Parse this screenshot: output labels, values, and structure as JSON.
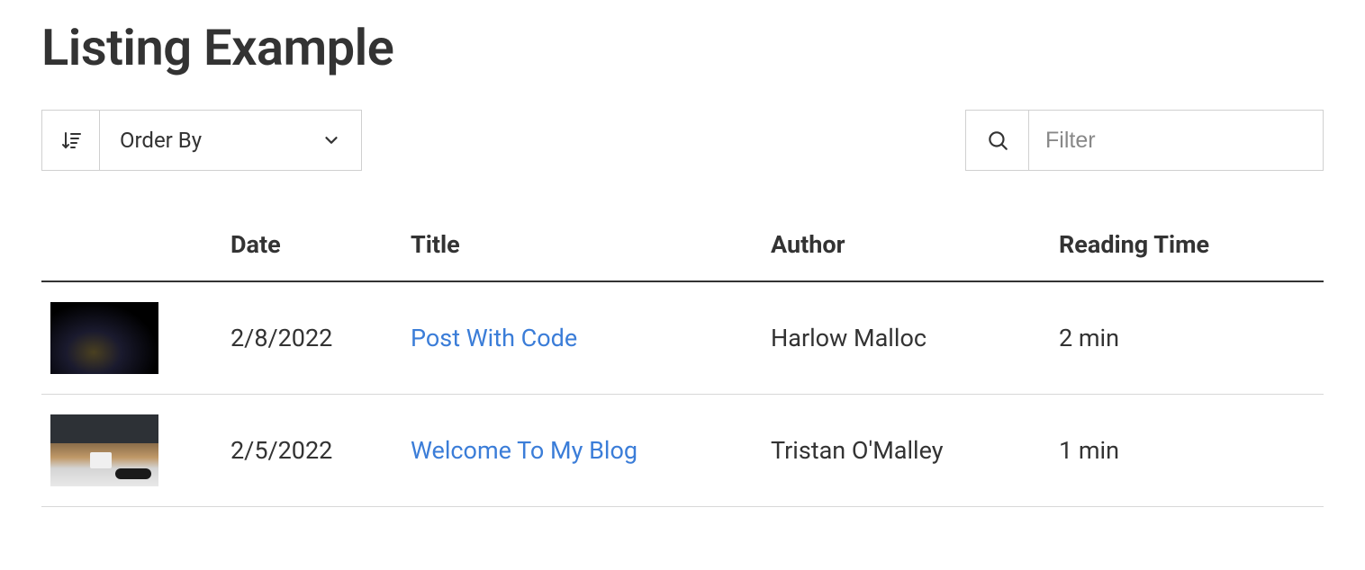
{
  "page": {
    "title": "Listing Example"
  },
  "toolbar": {
    "orderby_label": "Order By",
    "filter_placeholder": "Filter"
  },
  "table": {
    "headers": {
      "date": "Date",
      "title": "Title",
      "author": "Author",
      "reading_time": "Reading Time"
    },
    "rows": [
      {
        "date": "2/8/2022",
        "title": "Post With Code",
        "author": "Harlow Malloc",
        "reading_time": "2 min",
        "thumb_class": "thumb-night"
      },
      {
        "date": "2/5/2022",
        "title": "Welcome To My Blog",
        "author": "Tristan O'Malley",
        "reading_time": "1 min",
        "thumb_class": "thumb-desk"
      }
    ]
  }
}
